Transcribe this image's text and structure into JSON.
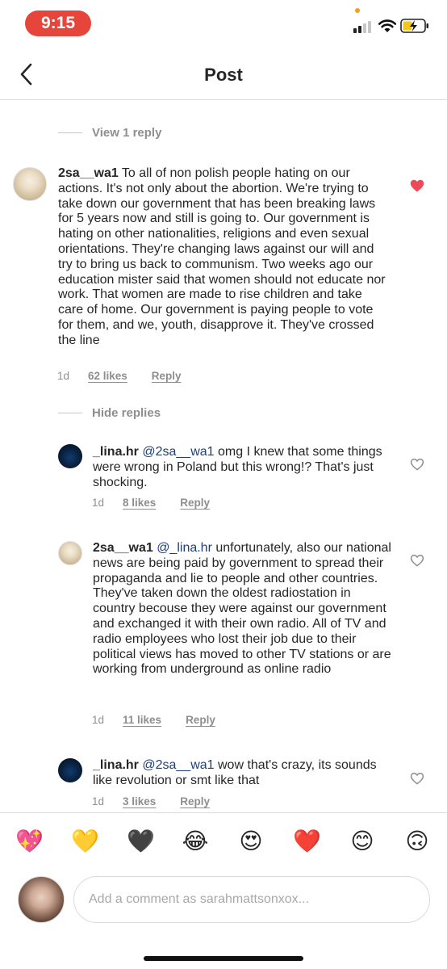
{
  "status_bar": {
    "time": "9:15"
  },
  "header": {
    "title": "Post"
  },
  "thread": {
    "view_replies_label": "View 1 reply",
    "hide_replies_label": "Hide replies"
  },
  "comments": [
    {
      "username": "2sa__wa1",
      "mention": "",
      "text": "To all of non polish people hating on our actions. It's not only about the abortion. We're trying to take down our government that has been breaking laws for 5 years now and still is going to. Our government is hating on other nationalities, religions and even sexual orientations. They're changing laws against our will and try to bring us back to communism. Two weeks ago our education mister said that women should not educate nor work. That women are made to rise children and take care of home. Our government is paying people to vote for them, and we, youth, disapprove it. They've crossed the line",
      "time": "1d",
      "likes": "62 likes",
      "reply_label": "Reply",
      "liked": true
    },
    {
      "username": "_lina.hr",
      "mention": "@2sa__wa1",
      "text": "omg I knew that some things were wrong in Poland but this wrong!? That's just shocking.",
      "time": "1d",
      "likes": "8 likes",
      "reply_label": "Reply",
      "liked": false
    },
    {
      "username": "2sa__wa1",
      "mention": "@_lina.hr",
      "text": "unfortunately, also our national news are being paid by government to spread their propaganda and lie to people and other countries. They've taken down the oldest radiostation in country becouse they were against our government and exchanged it with their own radio. All of TV and radio employees who lost their job due to their political views has moved to other TV stations or are working from underground as online radio",
      "time": "1d",
      "likes": "11 likes",
      "reply_label": "Reply",
      "liked": false
    },
    {
      "username": "_lina.hr",
      "mention": "@2sa__wa1",
      "text": "wow that's crazy, its sounds like revolution or smt like that",
      "time": "1d",
      "likes": "3 likes",
      "reply_label": "Reply",
      "liked": false
    }
  ],
  "emoji_bar": [
    "💖",
    "💛",
    "🖤",
    "😂",
    "😍",
    "❤️",
    "😊",
    "🙃"
  ],
  "composer": {
    "placeholder": "Add a comment as sarahmattsonxox..."
  },
  "colors": {
    "accent_red": "#ed4956",
    "status_pill": "#e5453b",
    "mention": "#1e3f78",
    "secondary_text": "#8e8e8e"
  }
}
